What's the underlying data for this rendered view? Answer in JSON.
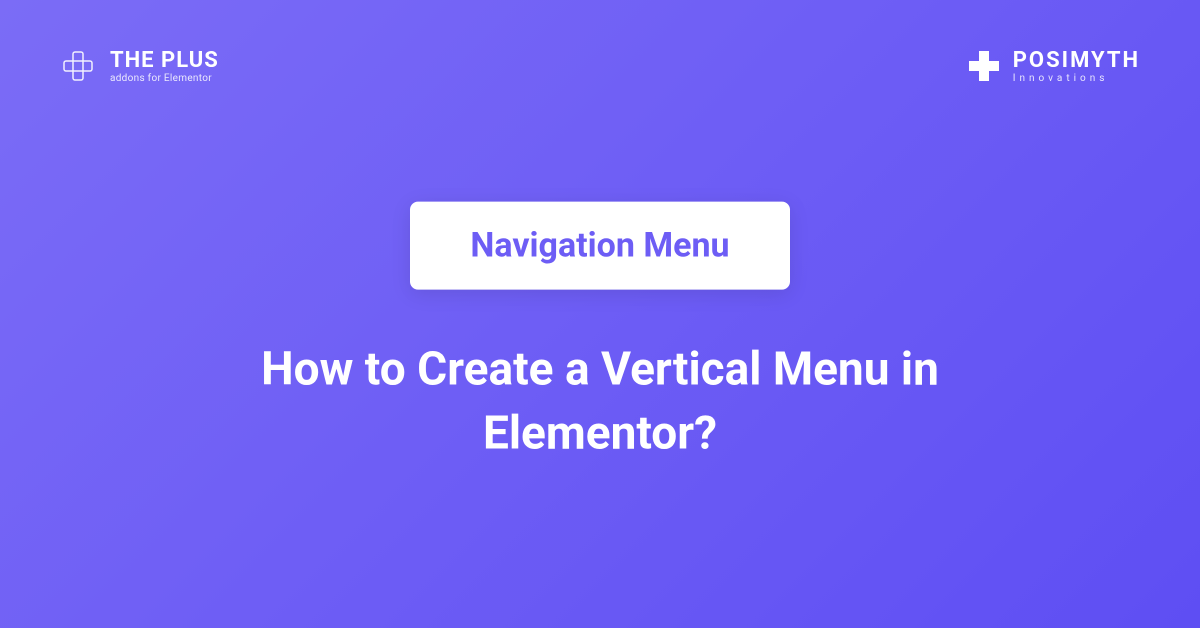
{
  "header": {
    "left_logo": {
      "title": "THE PLUS",
      "subtitle": "addons for Elementor"
    },
    "right_logo": {
      "title": "POSIMYTH",
      "subtitle": "Innovations"
    }
  },
  "content": {
    "badge_label": "Navigation Menu",
    "title": "How to Create a Vertical Menu in Elementor?"
  }
}
